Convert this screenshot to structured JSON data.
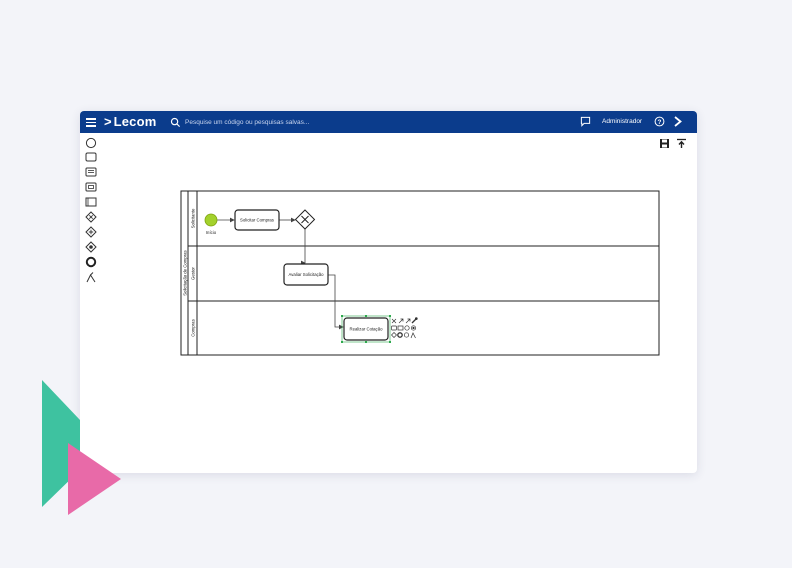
{
  "app": {
    "brand_mark": ">",
    "brand_name": "Lecom",
    "search_placeholder": "Pesquise um código ou pesquisas salvas...",
    "user_name": "Administrador"
  },
  "palette": {
    "tools": [
      "start-event-icon",
      "task-icon",
      "subprocess-icon",
      "data-object-icon",
      "pool-icon",
      "exclusive-gateway-icon",
      "parallel-gateway-icon",
      "inclusive-gateway-icon",
      "end-event-icon",
      "connector-icon"
    ]
  },
  "diagram": {
    "pool_label": "Solicitação de Compras",
    "lanes": [
      "Solicitante",
      "Gestor",
      "Compras"
    ],
    "start_label": "Início",
    "task1": "Solicitar Compras",
    "task2": "Avaliar Solicitação",
    "task3": "Realizar Cotação",
    "colors": {
      "brand": "#0b3c8c",
      "start": "#a3d12c",
      "selection": "#2ea84d",
      "teal": "#3ec2a0",
      "pink": "#e86aa8"
    }
  }
}
